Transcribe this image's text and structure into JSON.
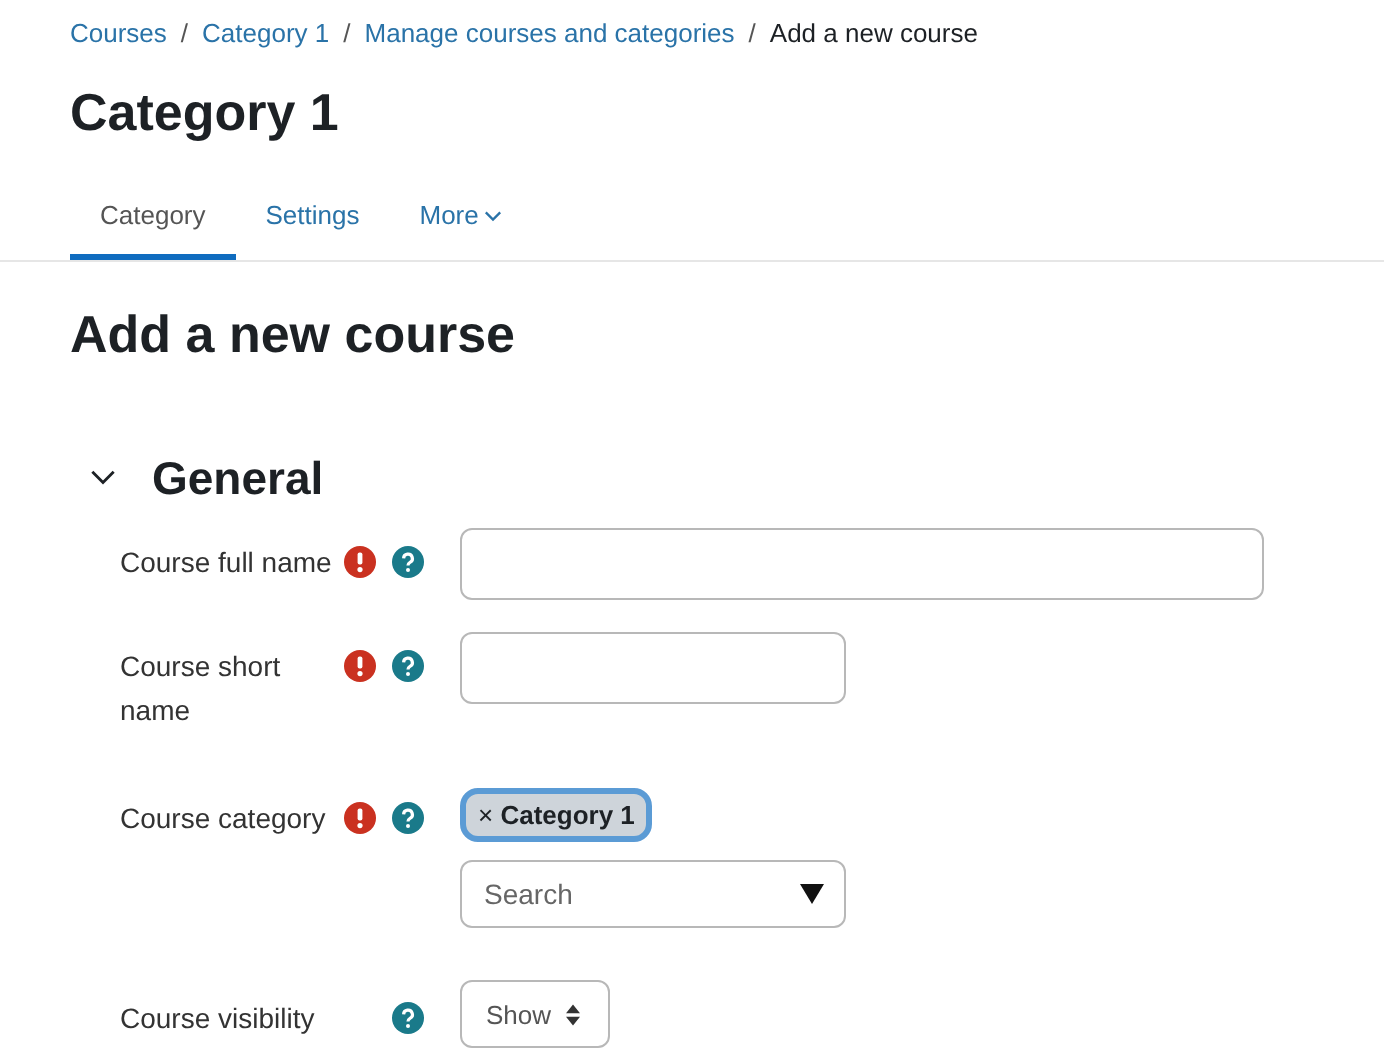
{
  "breadcrumb": [
    {
      "label": "Courses",
      "link": true
    },
    {
      "label": "Category 1",
      "link": true
    },
    {
      "label": "Manage courses and categories",
      "link": true
    },
    {
      "label": "Add a new course",
      "link": false
    }
  ],
  "separator": "/",
  "heading": "Category 1",
  "tabs": [
    {
      "label": "Category",
      "selected": true,
      "dropdown": false
    },
    {
      "label": "Settings",
      "selected": false,
      "dropdown": false
    },
    {
      "label": "More",
      "selected": false,
      "dropdown": true
    }
  ],
  "page_title": "Add a new course",
  "section": {
    "title": "General",
    "expanded": true
  },
  "fields": [
    {
      "kind": "text",
      "label": "Course full name",
      "required": true,
      "help": true,
      "wide": true
    },
    {
      "kind": "text",
      "label": "Course short name",
      "required": true,
      "help": true,
      "wide": false
    },
    {
      "kind": "autocomplete",
      "label": "Course category",
      "required": true,
      "help": true,
      "remove": "×",
      "chip": "Category 1",
      "placeholder": "Search"
    },
    {
      "kind": "select",
      "label": "Course visibility",
      "required": false,
      "help": true,
      "value": "Show"
    }
  ]
}
